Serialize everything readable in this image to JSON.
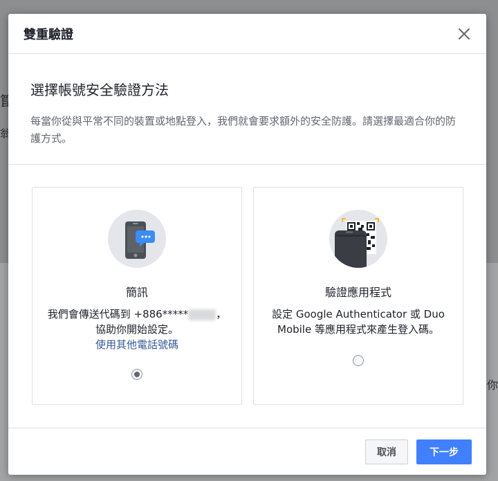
{
  "background": {
    "left_glyph_1": "箟",
    "left_glyph_2": "翁",
    "right_glyph": "你"
  },
  "dialog": {
    "title": "雙重驗證",
    "close_icon": "close-icon",
    "intro": {
      "heading": "選擇帳號安全驗證方法",
      "description": "每當你從與平常不同的裝置或地點登入，我們就會要求額外的安全防護。請選擇最適合你的防護方式。"
    },
    "options": [
      {
        "icon": "phone-message-icon",
        "title": "簡訊",
        "desc_line1_prefix": "我們會傳送代碼到 +886*****",
        "desc_line1_suffix": "，",
        "desc_line2": "協助你開始設定。",
        "link": "使用其他電話號碼",
        "selected": true
      },
      {
        "icon": "authenticator-qr-icon",
        "title": "驗證應用程式",
        "desc_line1": "設定 Google Authenticator 或 Duo",
        "desc_line2": "Mobile 等應用程式來產生登入碼。",
        "selected": false
      }
    ],
    "footer": {
      "cancel_label": "取消",
      "next_label": "下一步"
    }
  },
  "colors": {
    "primary": "#4080ff",
    "link": "#385898",
    "text": "#1d2129",
    "muted": "#606770"
  }
}
